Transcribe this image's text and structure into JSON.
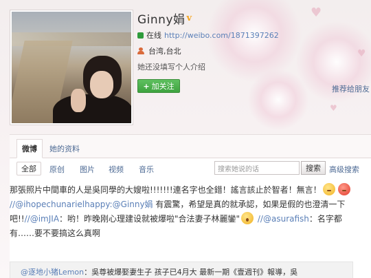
{
  "profile": {
    "name": "Ginny娟",
    "verified_mark": "v",
    "online_status": "在线",
    "url": "http://weibo.com/1871397262",
    "location": "台湾,台北",
    "bio": "她还没填写个人介绍",
    "follow_button": "加关注",
    "recommend_link": "推荐给朋友"
  },
  "tabs": [
    "微博",
    "她的资料"
  ],
  "filters": [
    "全部",
    "原创",
    "图片",
    "视频",
    "音乐"
  ],
  "search": {
    "placeholder": "搜索她说的话",
    "button": "搜索",
    "advanced": "高级搜索"
  },
  "post": {
    "line1": "那張照片中間車的人是吳同學的大嫂啦!!!!!!!連名字也全錯！謠言該止於智者！無言！",
    "line2_mention": "//@ihopechunarielhappy:",
    "line2_mention2": "@Ginny娟",
    "line2_text": " 有震驚，希望是真的就承認，如果是假的也澄清一下",
    "line3_text1": "吧!!",
    "line3_mention": "//@imJIA",
    "line3_text2": "：哟！昨晚刚心理建设就被爆啦\"合法妻子林麗鑾\"",
    "line3_mention2": " //@asurafish",
    "line3_text3": "：名字都",
    "line4": "有……要不要搞这么真啊"
  },
  "repost": {
    "author": "@逐地小猪Lemon",
    "text": "：吳尊被爆娶妻生子 孩子已4月大 最新一期《壹週刊》報導，吳"
  },
  "colors": {
    "link": "#5a7fb7",
    "follow_green": "#3ea33f",
    "verified_orange": "#f5a623"
  }
}
